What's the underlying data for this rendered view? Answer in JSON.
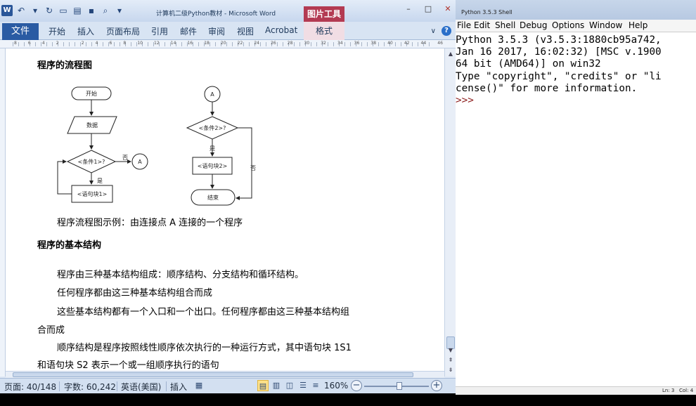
{
  "word": {
    "title": "计算机二级Python教材 - Microsoft Word",
    "contextual_header": "图片工具",
    "tabs": {
      "file": "文件",
      "home": "开始",
      "insert": "插入",
      "layout": "页面布局",
      "references": "引用",
      "mailings": "邮件",
      "review": "审阅",
      "view": "视图",
      "acrobat": "Acrobat",
      "format": "格式"
    },
    "ruler_numbers": [
      "8",
      "6",
      "4",
      "2",
      "",
      "2",
      "4",
      "6",
      "8",
      "10",
      "12",
      "14",
      "16",
      "18",
      "20",
      "22",
      "24",
      "26",
      "28",
      "30",
      "32",
      "34",
      "36",
      "38",
      "40",
      "42",
      "44",
      "46"
    ],
    "document": {
      "heading_flowchart": "程序的流程图",
      "flowchart": {
        "start": "开始",
        "data": "数据",
        "cond1": "<条件1>?",
        "no": "否",
        "yes1": "是",
        "block1": "<语句块1>",
        "connector": "A",
        "connector2": "A",
        "cond2": "<条件2>?",
        "yes2": "是",
        "block2": "<语句块2>",
        "no2": "否",
        "end": "结束"
      },
      "caption": "程序流程图示例：由连接点 A 连接的一个程序",
      "heading_structure": "程序的基本结构",
      "para1": "程序由三种基本结构组成：顺序结构、分支结构和循环结构。",
      "para2": "任何程序都由这三种基本结构组合而成",
      "para3_line1": "这些基本结构都有一个入口和一个出口。任何程序都由这三种基本结构组",
      "para3_line2": "合而成",
      "para4_line1": "顺序结构是程序按照线性顺序依次执行的一种运行方式，其中语句块 1S1",
      "para4_line2": "和语句块 S2 表示一个或一组顺序执行的语句"
    },
    "status": {
      "page": "页面: 40/148",
      "words": "字数: 60,242",
      "language": "英语(美国)",
      "mode": "插入",
      "zoom": "160%",
      "zoom_fraction": 0.55
    }
  },
  "shell": {
    "title": "Python 3.5.3 Shell",
    "menu": [
      "File",
      "Edit",
      "Shell",
      "Debug",
      "Options",
      "Window",
      "Help"
    ],
    "lines": [
      "Python 3.5.3 (v3.5.3:1880cb95a742,",
      "Jan 16 2017, 16:02:32) [MSC v.1900",
      "64 bit (AMD64)] on win32",
      "Type \"copyright\", \"credits\" or \"li",
      "cense()\" for more information."
    ],
    "prompt": ">>> ",
    "status_line": "Ln: 3",
    "status_col": "Col: 4"
  }
}
